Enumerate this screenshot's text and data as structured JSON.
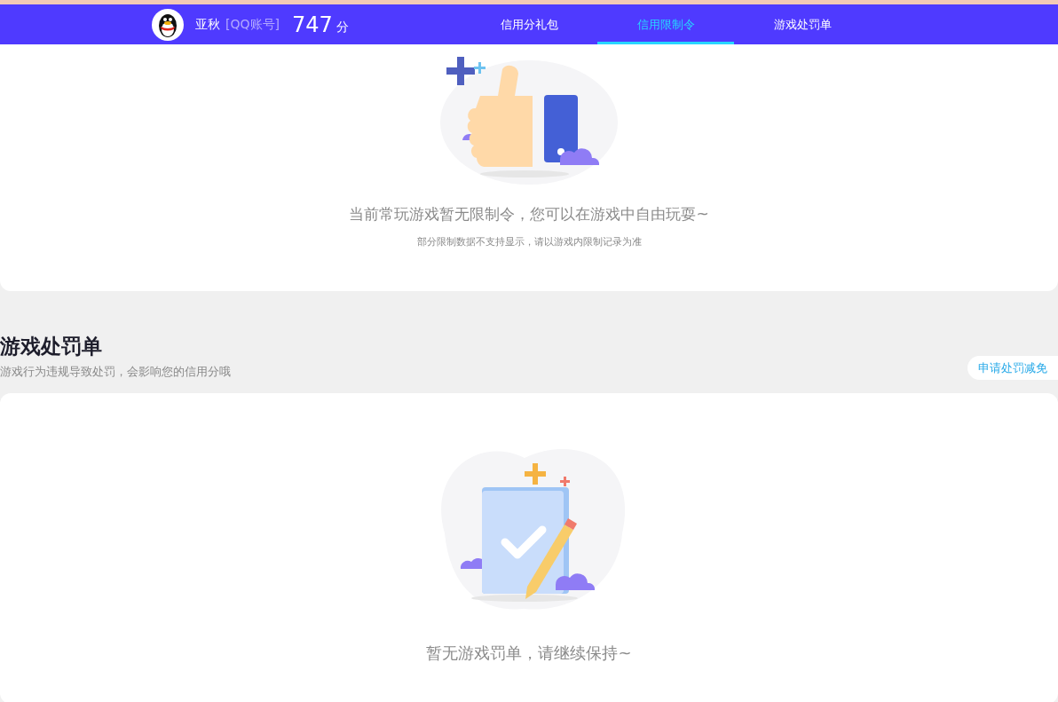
{
  "header": {
    "user_name": "亚秋",
    "account_type": "[QQ账号]",
    "score": "747",
    "score_unit": "分",
    "tabs": [
      {
        "label": "信用分礼包",
        "selected": false
      },
      {
        "label": "信用限制令",
        "selected": true
      },
      {
        "label": "游戏处罚单",
        "selected": false
      }
    ]
  },
  "restriction_card": {
    "message": "当前常玩游戏暂无限制令，您可以在游戏中自由玩耍~",
    "note": "部分限制数据不支持显示，请以游戏内限制记录为准"
  },
  "penalty_section": {
    "title": "游戏处罚单",
    "subtitle": "游戏行为违规导致处罚，会影响您的信用分哦",
    "action": "申请处罚减免",
    "empty_message": "暂无游戏罚单，请继续保持~"
  }
}
